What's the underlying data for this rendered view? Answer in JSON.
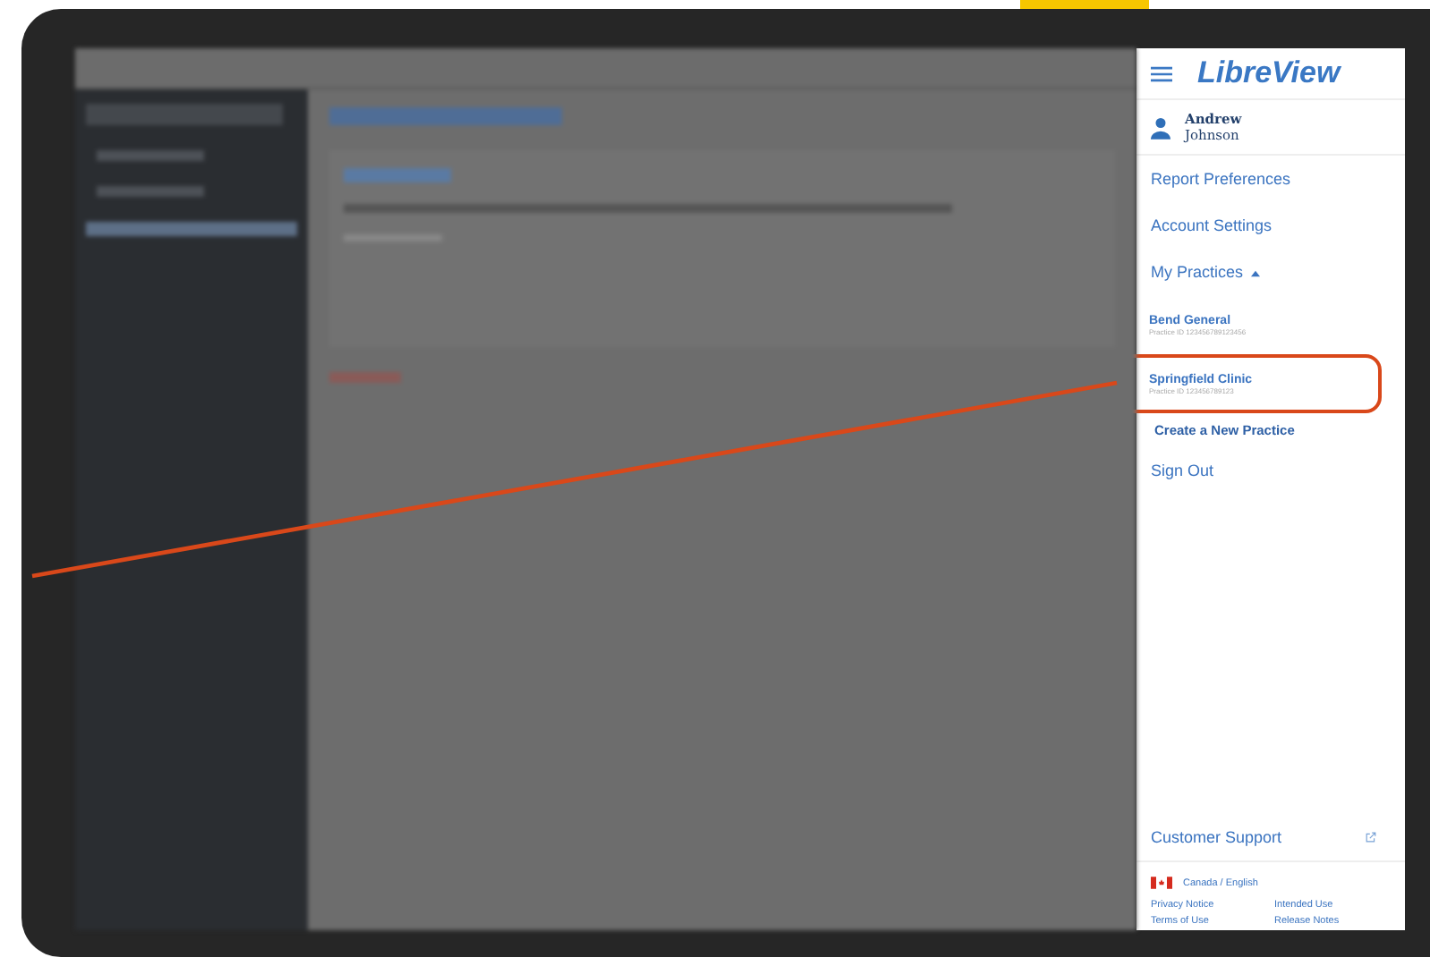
{
  "menu": {
    "logo": "LibreView",
    "user": {
      "first_name": "Andrew",
      "last_name": "Johnson"
    },
    "items": [
      {
        "label": "Report Preferences"
      },
      {
        "label": "Account Settings"
      }
    ],
    "practices": {
      "label": "My Practices",
      "expanded": true,
      "items": [
        {
          "name": "Bend General",
          "practice_id": "Practice ID 123456789123456",
          "highlighted": false
        },
        {
          "name": "Springfield Clinic",
          "practice_id": "Practice ID 123456789123",
          "highlighted": true
        }
      ],
      "create": "Create a New Practice"
    },
    "sign_out": "Sign Out",
    "support": "Customer Support",
    "locale": "Canada / English",
    "links": [
      "Privacy Notice",
      "Intended Use",
      "Terms of Use",
      "Release Notes"
    ]
  }
}
